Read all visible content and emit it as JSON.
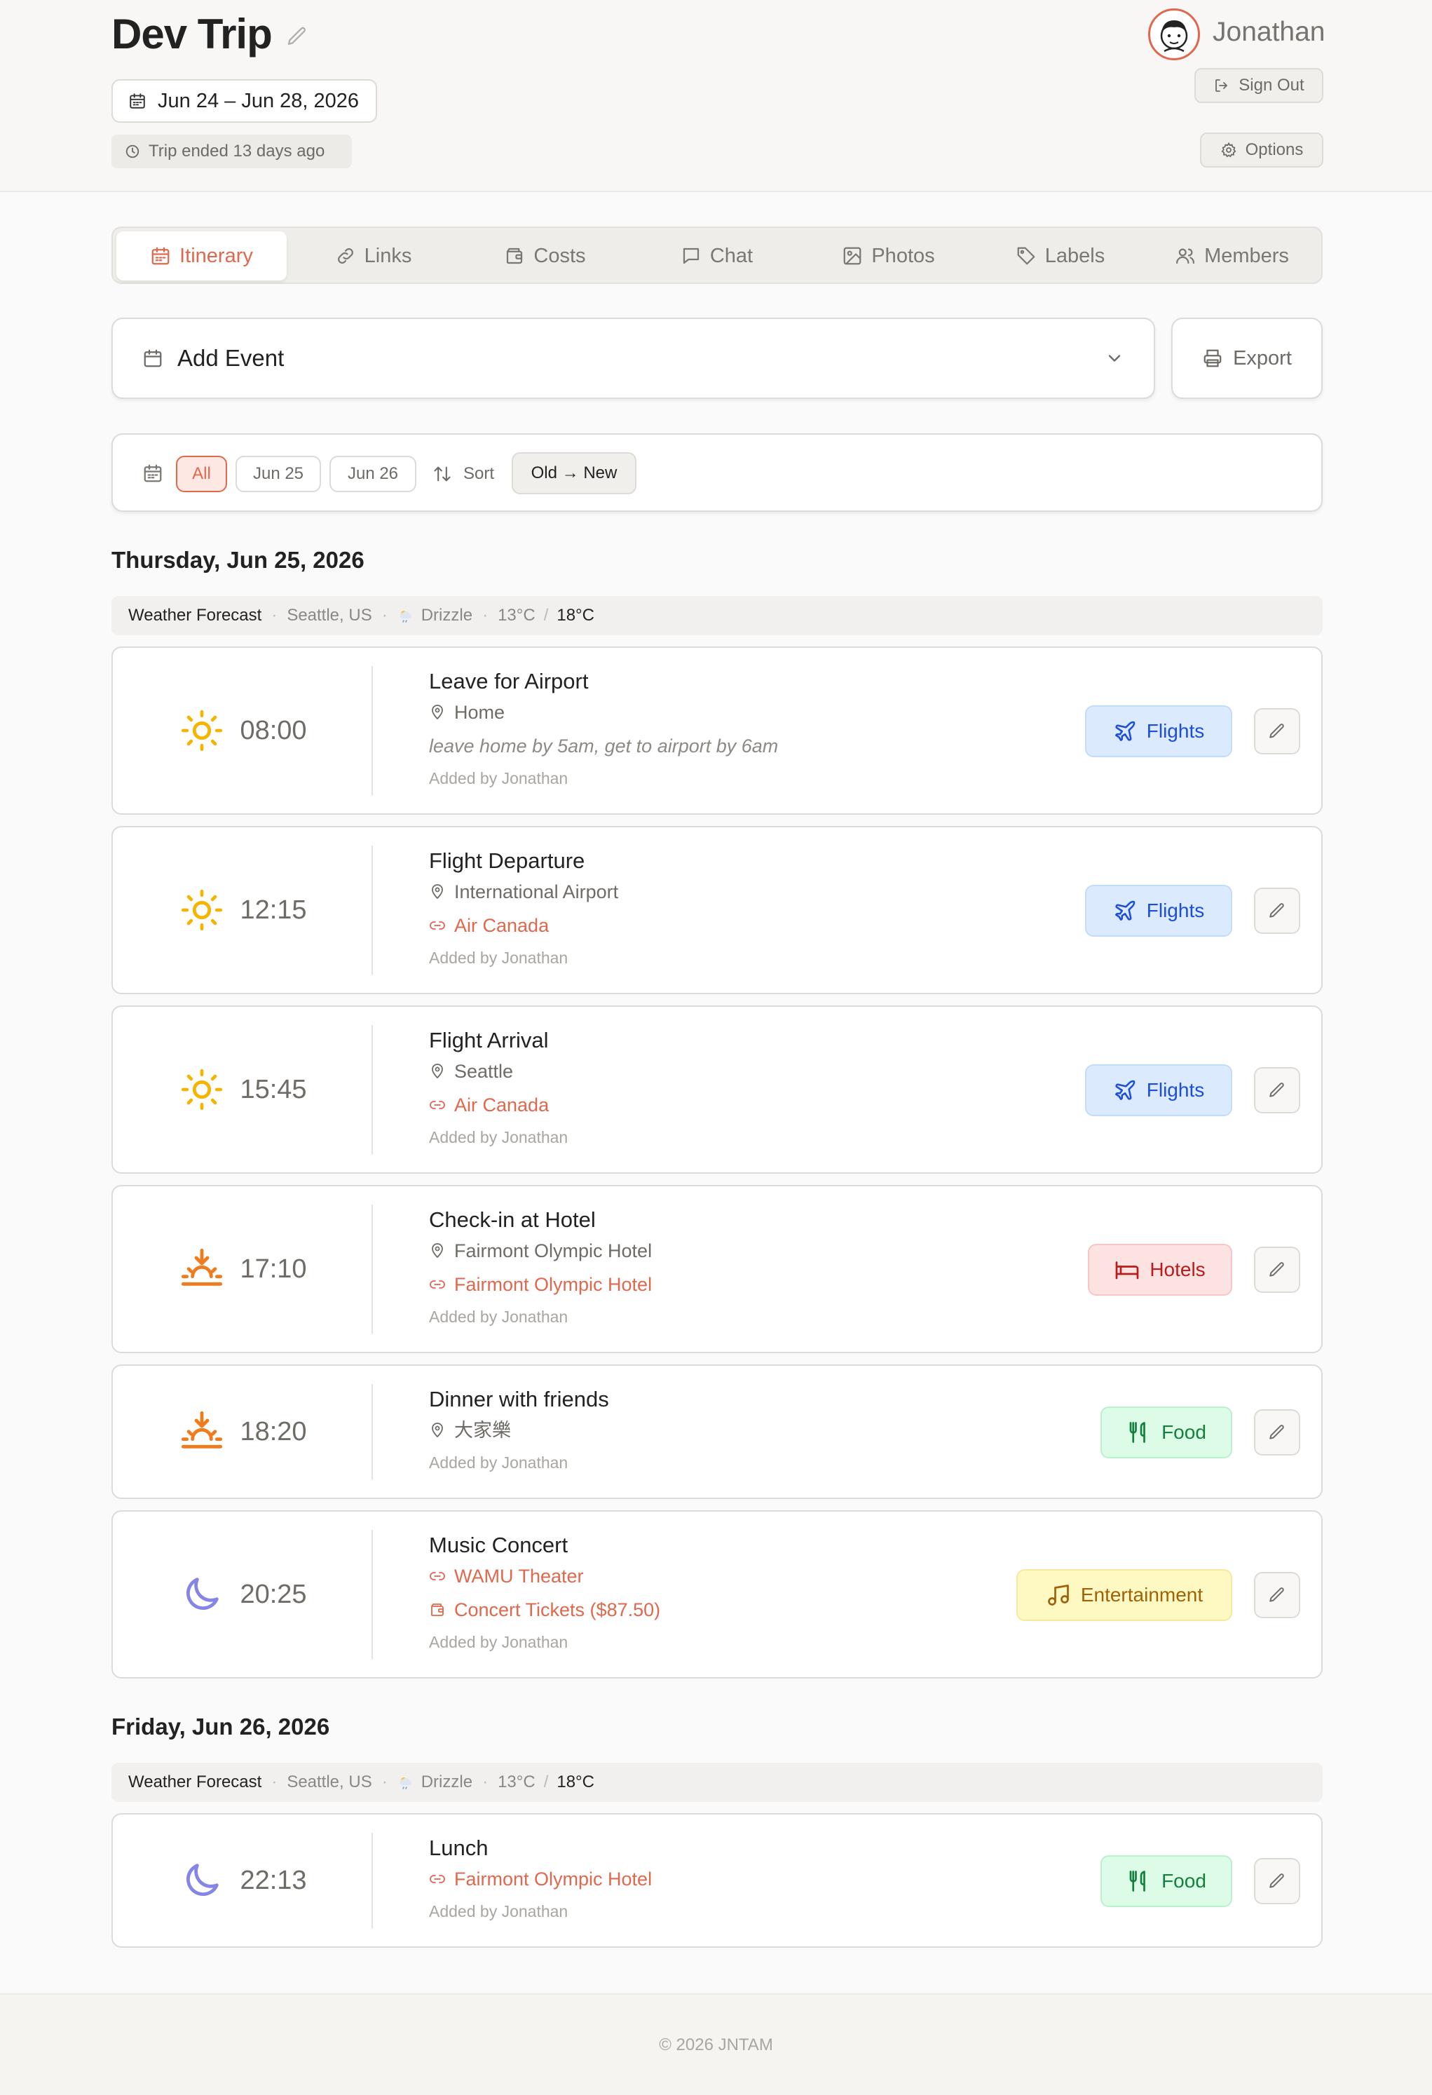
{
  "header": {
    "trip_title": "Dev Trip",
    "date_range": "Jun 24 – Jun 28, 2026",
    "trip_status": "Trip ended 13 days ago",
    "user_name": "Jonathan",
    "sign_out_label": "Sign Out",
    "options_label": "Options"
  },
  "tabs": [
    {
      "label": "Itinerary",
      "icon": "calendar-icon",
      "active": true
    },
    {
      "label": "Links",
      "icon": "link-icon"
    },
    {
      "label": "Costs",
      "icon": "wallet-icon"
    },
    {
      "label": "Chat",
      "icon": "chat-icon"
    },
    {
      "label": "Photos",
      "icon": "image-icon"
    },
    {
      "label": "Labels",
      "icon": "tag-icon"
    },
    {
      "label": "Members",
      "icon": "users-icon"
    }
  ],
  "actions": {
    "add_event_label": "Add Event",
    "export_label": "Export"
  },
  "filters": {
    "chips": [
      "All",
      "Jun 25",
      "Jun 26"
    ],
    "selected": "All",
    "sort_label": "Sort",
    "sort_order": "Old → New"
  },
  "days": [
    {
      "heading": "Thursday, Jun 25, 2026",
      "weather": {
        "label": "Weather Forecast",
        "location": "Seattle, US",
        "condition": "Drizzle",
        "low": "13°C",
        "high": "18°C"
      },
      "events": [
        {
          "time": "08:00",
          "time_icon": "sun-icon",
          "title": "Leave for Airport",
          "location": "Home",
          "note": "leave home by 5am, get to airport by 6am",
          "added_by": "Added by Jonathan",
          "label": "Flights"
        },
        {
          "time": "12:15",
          "time_icon": "sun-icon",
          "title": "Flight Departure",
          "location": "International Airport",
          "link": "Air Canada",
          "added_by": "Added by Jonathan",
          "label": "Flights"
        },
        {
          "time": "15:45",
          "time_icon": "sun-icon",
          "title": "Flight Arrival",
          "location": "Seattle",
          "link": "Air Canada",
          "added_by": "Added by Jonathan",
          "label": "Flights"
        },
        {
          "time": "17:10",
          "time_icon": "sunset-icon",
          "title": "Check-in at Hotel",
          "location": "Fairmont Olympic Hotel",
          "link": "Fairmont Olympic Hotel",
          "added_by": "Added by Jonathan",
          "label": "Hotels"
        },
        {
          "time": "18:20",
          "time_icon": "sunset-icon",
          "title": "Dinner with friends",
          "location": "大家樂",
          "added_by": "Added by Jonathan",
          "label": "Food"
        },
        {
          "time": "20:25",
          "time_icon": "moon-icon",
          "title": "Music Concert",
          "link": "WAMU Theater",
          "cost": "Concert Tickets ($87.50)",
          "added_by": "Added by Jonathan",
          "label": "Entertainment"
        }
      ]
    },
    {
      "heading": "Friday, Jun 26, 2026",
      "weather": {
        "label": "Weather Forecast",
        "location": "Seattle, US",
        "condition": "Drizzle",
        "low": "13°C",
        "high": "18°C"
      },
      "events": [
        {
          "time": "22:13",
          "time_icon": "moon-icon",
          "title": "Lunch",
          "link": "Fairmont Olympic Hotel",
          "added_by": "Added by Jonathan",
          "label": "Food"
        }
      ]
    }
  ],
  "footer": {
    "copyright": "© 2026 JNTAM"
  },
  "colors": {
    "accent": "#e0684d",
    "flights": "#1d4ed8",
    "hotels": "#b91c1c",
    "food": "#15803d",
    "entertainment": "#a16207",
    "sun": "#f5b400",
    "sunset": "#f07b1c",
    "moon": "#8585e8"
  }
}
